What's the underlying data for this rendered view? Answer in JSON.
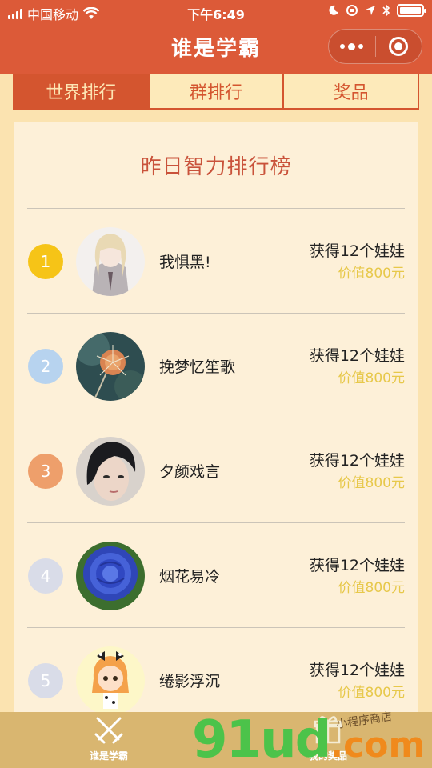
{
  "status_bar": {
    "carrier": "中国移动",
    "time": "下午6:49"
  },
  "nav": {
    "title": "谁是学霸"
  },
  "tabs": [
    {
      "label": "世界排行",
      "active": true
    },
    {
      "label": "群排行",
      "active": false
    },
    {
      "label": "奖品",
      "active": false
    }
  ],
  "card": {
    "title": "昨日智力排行榜"
  },
  "ranking": [
    {
      "rank": "1",
      "name": "我惧黑!",
      "prize": "获得12个娃娃",
      "value": "价值800元",
      "badge_color": "#f6c417"
    },
    {
      "rank": "2",
      "name": "挽梦忆笙歌",
      "prize": "获得12个娃娃",
      "value": "价值800元",
      "badge_color": "#b7d3ef"
    },
    {
      "rank": "3",
      "name": "夕颜戏言",
      "prize": "获得12个娃娃",
      "value": "价值800元",
      "badge_color": "#ee9f6b"
    },
    {
      "rank": "4",
      "name": "烟花易冷",
      "prize": "获得12个娃娃",
      "value": "价值800元",
      "badge_color": "#d9dce8"
    },
    {
      "rank": "5",
      "name": "绻影浮沉",
      "prize": "获得12个娃娃",
      "value": "价值800元",
      "badge_color": "#d9dce8"
    }
  ],
  "tabbar": {
    "items": [
      {
        "label": "谁是学霸",
        "icon": "crossed-swords-icon"
      },
      {
        "label": "我的奖品",
        "icon": "gift-icon"
      }
    ]
  },
  "watermark": {
    "main": "91ud",
    "suffix": ".com",
    "script": "小程序商店"
  },
  "colors": {
    "accent": "#dc5a38",
    "background": "#fbe3b0",
    "card": "#fdf0d8",
    "prize_value": "#e7c84a"
  }
}
